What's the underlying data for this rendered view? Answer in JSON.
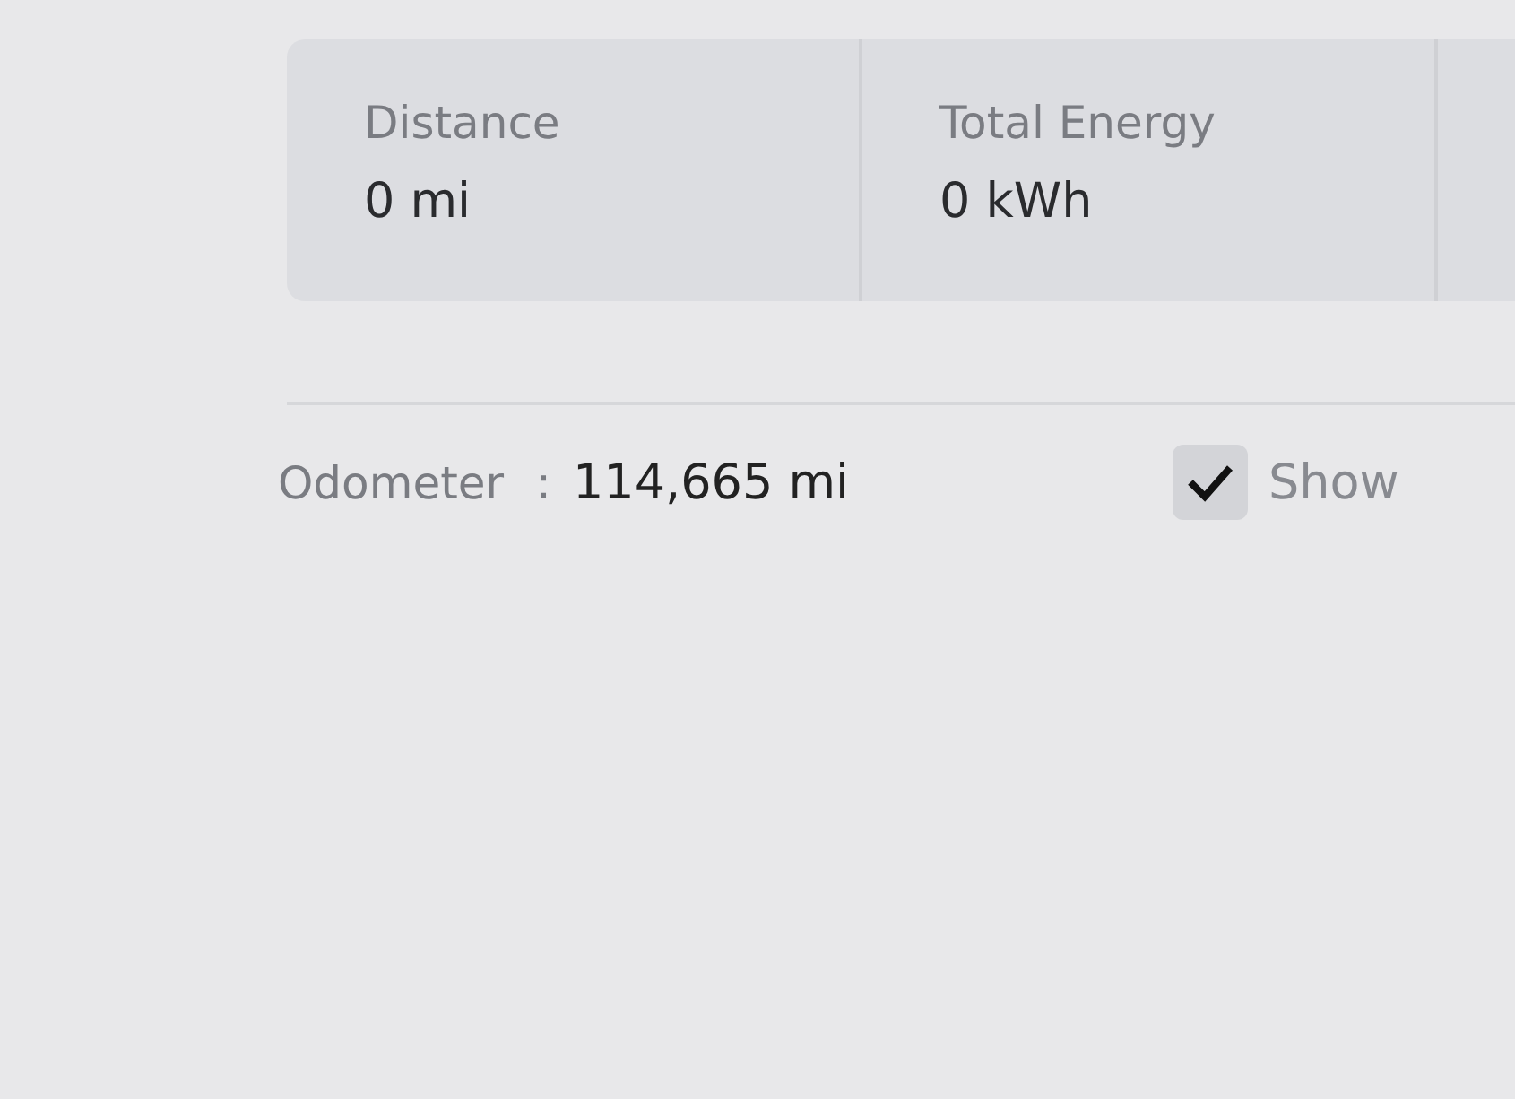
{
  "stats": [
    {
      "label": "Distance",
      "value": "0 mi"
    },
    {
      "label": "Total Energy",
      "value": "0 kWh"
    }
  ],
  "odometer": {
    "label": "Odometer",
    "separator": ":",
    "value": "114,665 mi"
  },
  "show_option": {
    "label": "Show",
    "checked": true
  }
}
